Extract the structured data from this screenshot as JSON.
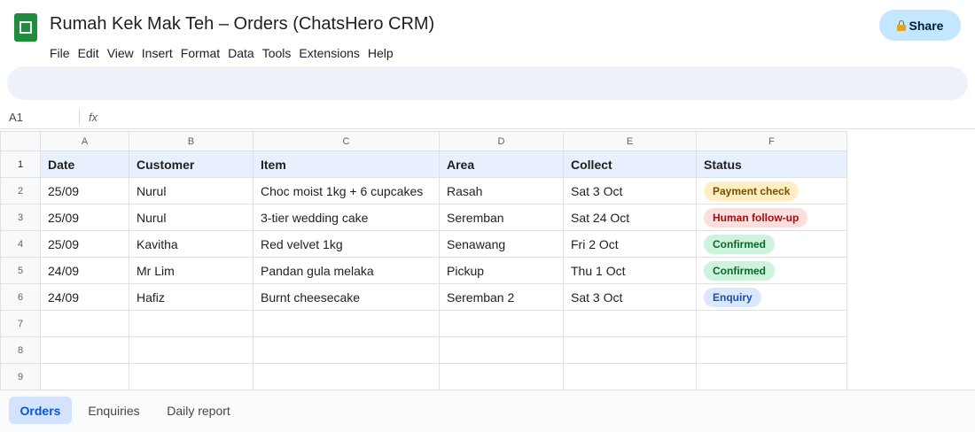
{
  "header": {
    "title": "Rumah Kek Mak Teh – Orders (ChatsHero CRM)",
    "share_label": "Share",
    "menu": [
      "File",
      "Edit",
      "View",
      "Insert",
      "Format",
      "Data",
      "Tools",
      "Extensions",
      "Help"
    ]
  },
  "formula_bar": {
    "cell_ref": "A1",
    "fx_label": "fx"
  },
  "grid": {
    "column_letters": [
      "A",
      "B",
      "C",
      "D",
      "E",
      "F"
    ],
    "row_numbers": [
      "1",
      "2",
      "3",
      "4",
      "5",
      "6",
      "7",
      "8",
      "9"
    ],
    "headers": [
      "Date",
      "Customer",
      "Item",
      "Area",
      "Collect",
      "Status"
    ],
    "rows": [
      {
        "date": "25/09",
        "customer": "Nurul",
        "item": "Choc moist 1kg + 6 cupcakes",
        "area": "Rasah",
        "collect": "Sat 3 Oct",
        "status": "Payment check"
      },
      {
        "date": "25/09",
        "customer": "Nurul",
        "item": "3-tier wedding cake",
        "area": "Seremban",
        "collect": "Sat 24 Oct",
        "status": "Human follow-up"
      },
      {
        "date": "25/09",
        "customer": "Kavitha",
        "item": "Red velvet 1kg",
        "area": "Senawang",
        "collect": "Fri 2 Oct",
        "status": "Confirmed"
      },
      {
        "date": "24/09",
        "customer": "Mr Lim",
        "item": "Pandan gula melaka",
        "area": "Pickup",
        "collect": "Thu 1 Oct",
        "status": "Confirmed"
      },
      {
        "date": "24/09",
        "customer": "Hafiz",
        "item": "Burnt cheesecake",
        "area": "Seremban 2",
        "collect": "Sat 3 Oct",
        "status": "Enquiry"
      }
    ]
  },
  "status_colors": {
    "Payment check": {
      "bg": "#fdefc3",
      "fg": "#7a4d00"
    },
    "Human follow-up": {
      "bg": "#fbdede",
      "fg": "#a50e0e"
    },
    "Confirmed": {
      "bg": "#cdf3dc",
      "fg": "#0d652d"
    },
    "Enquiry": {
      "bg": "#dbe7fc",
      "fg": "#1a4fb0"
    }
  },
  "sheet_tabs": [
    {
      "label": "Orders",
      "active": true
    },
    {
      "label": "Enquiries",
      "active": false
    },
    {
      "label": "Daily report",
      "active": false
    }
  ]
}
